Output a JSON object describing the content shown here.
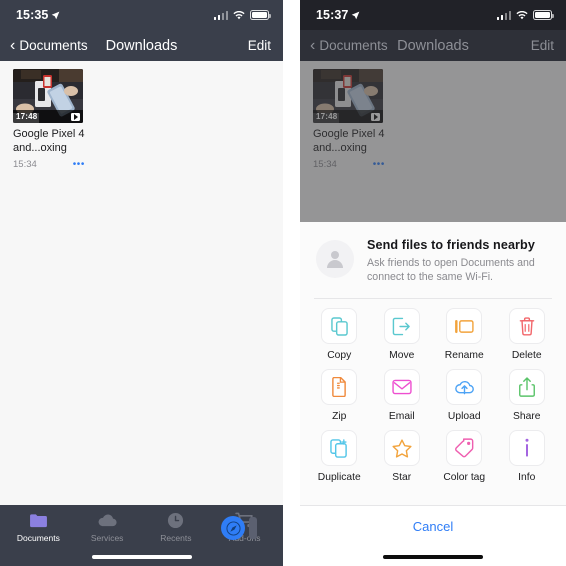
{
  "left_screen": {
    "status_bar": {
      "time": "15:35",
      "location_icon": "location-arrow-icon",
      "signal_icon": "cellular-signal-icon",
      "wifi_icon": "wifi-icon",
      "battery_icon": "battery-icon"
    },
    "nav_bar": {
      "back_icon": "chevron-left-icon",
      "back_label": "Documents",
      "title": "Downloads",
      "edit_label": "Edit"
    },
    "file": {
      "duration": "17:48",
      "play_badge_icon": "video-play-badge-icon",
      "name": "Google Pixel 4 and...oxing",
      "time": "15:34",
      "more_icon": "•••"
    },
    "tab_bar": {
      "tabs": [
        {
          "label": "Documents",
          "icon": "folder-icon",
          "active": true
        },
        {
          "label": "Services",
          "icon": "cloud-icon",
          "active": false
        },
        {
          "label": "Recents",
          "icon": "clock-icon",
          "active": false
        },
        {
          "label": "Add-ons",
          "icon": "cart-icon",
          "active": false
        }
      ],
      "browser_icon": "safari-compass-icon"
    }
  },
  "right_screen": {
    "status_bar": {
      "time": "15:37",
      "location_icon": "location-arrow-icon",
      "signal_icon": "cellular-signal-icon",
      "wifi_icon": "wifi-icon",
      "battery_icon": "battery-icon"
    },
    "nav_bar": {
      "back_icon": "chevron-left-icon",
      "back_label": "Documents",
      "title": "Downloads",
      "edit_label": "Edit"
    },
    "file": {
      "duration": "17:48",
      "play_badge_icon": "video-play-badge-icon",
      "name": "Google Pixel 4 and...oxing",
      "time": "15:34",
      "more_icon": "•••"
    },
    "action_sheet": {
      "header": {
        "avatar_icon": "person-avatar-icon",
        "title": "Send files to friends nearby",
        "subtitle": "Ask friends to open Documents and connect to the same Wi-Fi."
      },
      "actions": [
        {
          "label": "Copy",
          "icon": "copy-icon",
          "color": "#5ac8cf"
        },
        {
          "label": "Move",
          "icon": "move-icon",
          "color": "#5ac8cf"
        },
        {
          "label": "Rename",
          "icon": "rename-icon",
          "color": "#f2a33c"
        },
        {
          "label": "Delete",
          "icon": "trash-icon",
          "color": "#f2676b"
        },
        {
          "label": "Zip",
          "icon": "zip-icon",
          "color": "#f08a3c"
        },
        {
          "label": "Email",
          "icon": "email-icon",
          "color": "#ee4fd0"
        },
        {
          "label": "Upload",
          "icon": "upload-cloud-icon",
          "color": "#4da3f5"
        },
        {
          "label": "Share",
          "icon": "share-icon",
          "color": "#5bc46a"
        },
        {
          "label": "Duplicate",
          "icon": "duplicate-icon",
          "color": "#53c6e8"
        },
        {
          "label": "Star",
          "icon": "star-icon",
          "color": "#f2a33c"
        },
        {
          "label": "Color tag",
          "icon": "color-tag-icon",
          "color": "#ef5fb0"
        },
        {
          "label": "Info",
          "icon": "info-icon",
          "color": "#a465e0"
        }
      ],
      "cancel_label": "Cancel"
    }
  }
}
